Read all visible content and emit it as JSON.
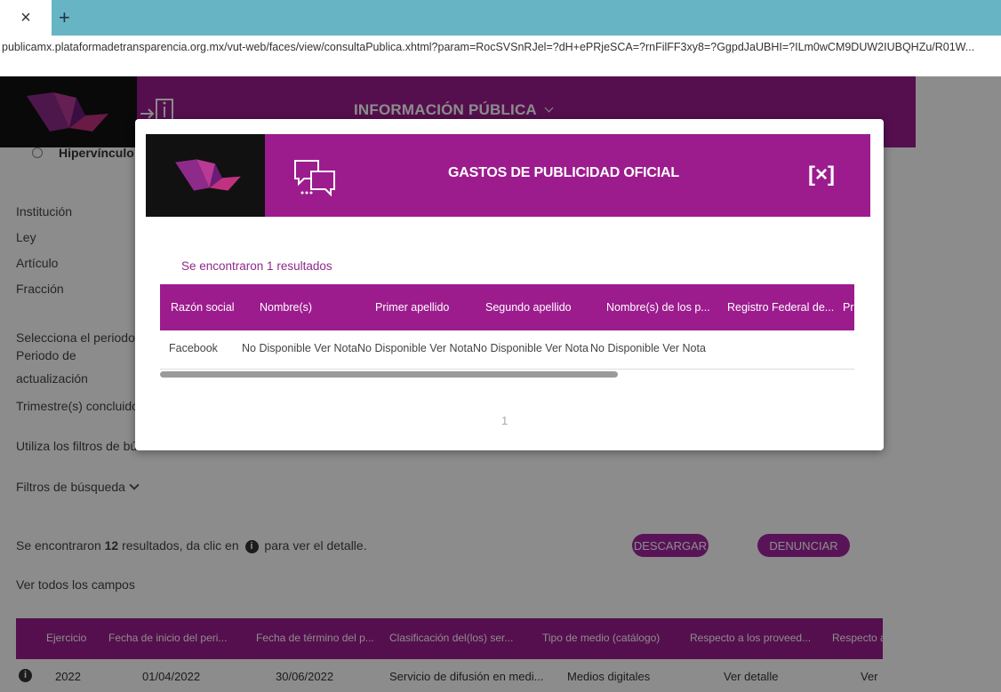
{
  "browser": {
    "tab_close": "×",
    "new_tab": "+",
    "url": "publicamx.plataformadetransparencia.org.mx/vut-web/faces/view/consultaPublica.xhtml?param=RocSVSnRJel=?dH+ePRjeSCA=?rnFilFF3xy8=?GgpdJaUBHI=?ILm0wCM9DUW2IUBQHZu/R01W..."
  },
  "header": {
    "info_label": "INFORMACIÓN PÚBLICA"
  },
  "background": {
    "hipervinculo": "Hipervínculo a",
    "labels": [
      "Institución",
      "Ley",
      "Artículo",
      "Fracción"
    ],
    "periodo_select": "Selecciona el periodo",
    "periodo_act_1": "Periodo de",
    "periodo_act_2": "actualización",
    "trimestres": "Trimestre(s) concluido",
    "filtros_hint": "Utiliza los filtros de bú",
    "filtros_busqueda": "Filtros de búsqueda",
    "found_prefix": "Se encontraron",
    "found_count": "12",
    "found_suffix": "resultados, da clic en",
    "found_end": "para ver el detalle.",
    "descargar": "DESCARGAR",
    "denunciar": "DENUNCIAR",
    "ver_todos": "Ver todos los campos",
    "table_headers": [
      "Ejercicio",
      "Fecha de inicio del peri...",
      "Fecha de término del p...",
      "Clasificación del(los) ser...",
      "Tipo de medio (catálogo)",
      "Respecto a los proveed...",
      "Respecto a"
    ],
    "table_row": [
      "2022",
      "01/04/2022",
      "30/06/2022",
      "Servicio de difusión en medi...",
      "Medios digitales",
      "Ver detalle",
      "Ver"
    ]
  },
  "modal": {
    "title": "GASTOS DE PUBLICIDAD OFICIAL",
    "close": "[×]",
    "found": "Se encontraron 1 resultados",
    "headers": [
      "Razón social",
      "Nombre(s)",
      "Primer apellido",
      "Segundo apellido",
      "Nombre(s) de los p...",
      "Registro Federal de...",
      "Pr"
    ],
    "row": [
      "Facebook",
      "No Disponible Ver Nota",
      "No Disponible Ver Nota",
      "No Disponible Ver Nota",
      "No Disponible Ver Nota"
    ],
    "page": "1",
    "scroll_fraction": 0.66
  },
  "colors": {
    "brand_purple": "#9c1c8e",
    "tab_teal": "#67b5c4"
  },
  "icons": [
    "close-icon",
    "plus-icon",
    "logo-icon",
    "door-icon",
    "chevron-down-icon",
    "chat-icon",
    "info-icon"
  ]
}
